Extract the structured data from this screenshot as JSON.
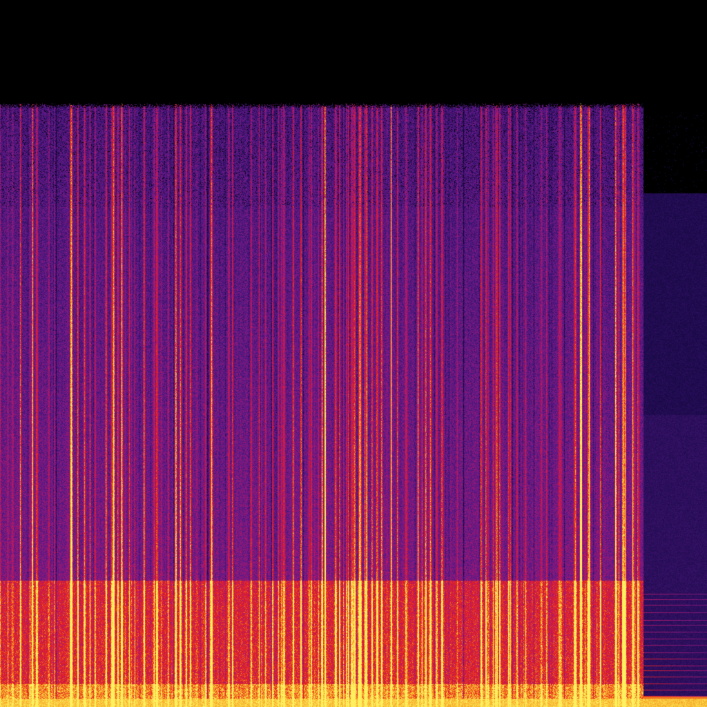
{
  "image": {
    "kind": "spectrogram",
    "colormap": "inferno-like",
    "palette": {
      "background": "#000000",
      "low": "#1a0a4a",
      "mid_low": "#5a1a8a",
      "mid": "#b0186a",
      "high": "#e8201e",
      "peak": "#f5a020",
      "max": "#fff060"
    },
    "text_labels": []
  }
}
